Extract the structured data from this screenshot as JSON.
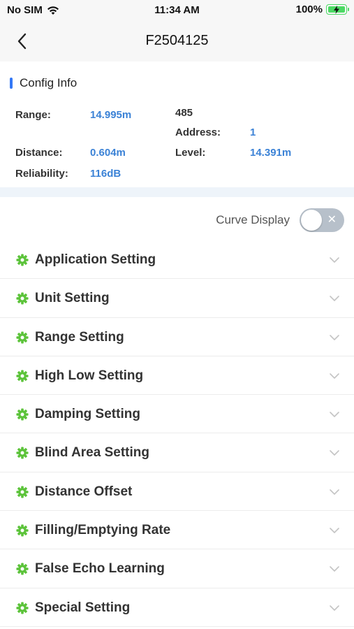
{
  "status_bar": {
    "carrier": "No SIM",
    "time": "11:34 AM",
    "battery": "100%"
  },
  "nav": {
    "title": "F2504125"
  },
  "config": {
    "section_title": "Config Info",
    "range_label": "Range:",
    "range_value": "14.995m",
    "protocol": "485",
    "address_label": "Address:",
    "address_value": "1",
    "distance_label": "Distance:",
    "distance_value": "0.604m",
    "level_label": "Level:",
    "level_value": "14.391m",
    "reliability_label": "Reliability:",
    "reliability_value": "116dB"
  },
  "curve_display": {
    "label": "Curve Display",
    "enabled": false,
    "off_glyph": "✕"
  },
  "settings": [
    {
      "label": "Application Setting"
    },
    {
      "label": "Unit Setting"
    },
    {
      "label": "Range Setting"
    },
    {
      "label": "High Low Setting"
    },
    {
      "label": "Damping Setting"
    },
    {
      "label": "Blind Area Setting"
    },
    {
      "label": "Distance Offset"
    },
    {
      "label": "Filling/Emptying Rate"
    },
    {
      "label": "False Echo Learning"
    },
    {
      "label": "Special Setting"
    }
  ],
  "icons": {
    "wifi": "wifi-icon",
    "battery": "battery-icon",
    "back": "chevron-left-icon",
    "gear": "gear-icon",
    "expand": "chevron-down-icon"
  },
  "colors": {
    "accent": "#3478f6",
    "value_blue": "#3b82d6",
    "gear_green": "#5cc33a",
    "toggle_off": "#b7c0ca",
    "band": "#eef4fa"
  }
}
